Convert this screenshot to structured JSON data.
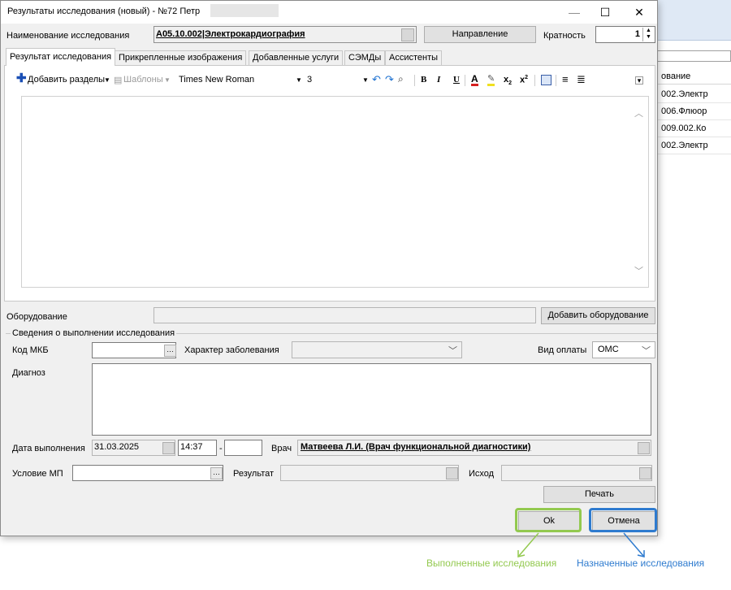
{
  "background_window": {
    "column_header": "ование",
    "rows": [
      "002.Электр",
      "006.Флюор",
      "009.002.Ко",
      "002.Электр"
    ]
  },
  "dialog": {
    "title": "Результаты исследования (новый) - №72 Петр",
    "controls": {
      "minimize": "—",
      "maximize": "☐",
      "close": "✕"
    },
    "study_name_label": "Наименование исследования",
    "study_name_value": "A05.10.002|Электрокардиография",
    "direction_button": "Направление",
    "multiplicity_label": "Кратность",
    "multiplicity_value": "1",
    "tabs": [
      "Результат исследования",
      "Прикрепленные изображения",
      "Добавленные услуги",
      "СЭМДы",
      "Ассистенты"
    ],
    "toolbar": {
      "add_sections": "Добавить разделы",
      "templates": "Шаблоны",
      "font_name": "Times New Roman",
      "font_size": "3",
      "bold": "B",
      "italic": "I",
      "underline": "U",
      "font_color": "A",
      "subscript": "x",
      "superscript": "x"
    },
    "equipment_label": "Оборудование",
    "add_equipment_button": "Добавить оборудование",
    "execution_group": {
      "caption": "Сведения о выполнении исследования",
      "mkb_label": "Код МКБ",
      "mkb_value": "",
      "disease_nature_label": "Характер заболевания",
      "payment_label": "Вид оплаты",
      "payment_value": "ОМС",
      "diagnosis_label": "Диагноз",
      "date_label": "Дата выполнения",
      "date_value": "31.03.2025",
      "time_from": "14:37",
      "time_dash": "-",
      "time_to": "",
      "doctor_label": "Врач",
      "doctor_value": "Матвеева Л.И. (Врач функциональной диагностики)"
    },
    "condition_label": "Условие МП",
    "result_label": "Результат",
    "outcome_label": "Исход",
    "print_button": "Печать",
    "ok_button": "Ok",
    "cancel_button": "Отмена"
  },
  "annotations": {
    "ok_note": "Выполненные исследования",
    "cancel_note": "Назначенные исследования",
    "ok_color": "#93c94f",
    "cancel_color": "#2e7bcf"
  }
}
